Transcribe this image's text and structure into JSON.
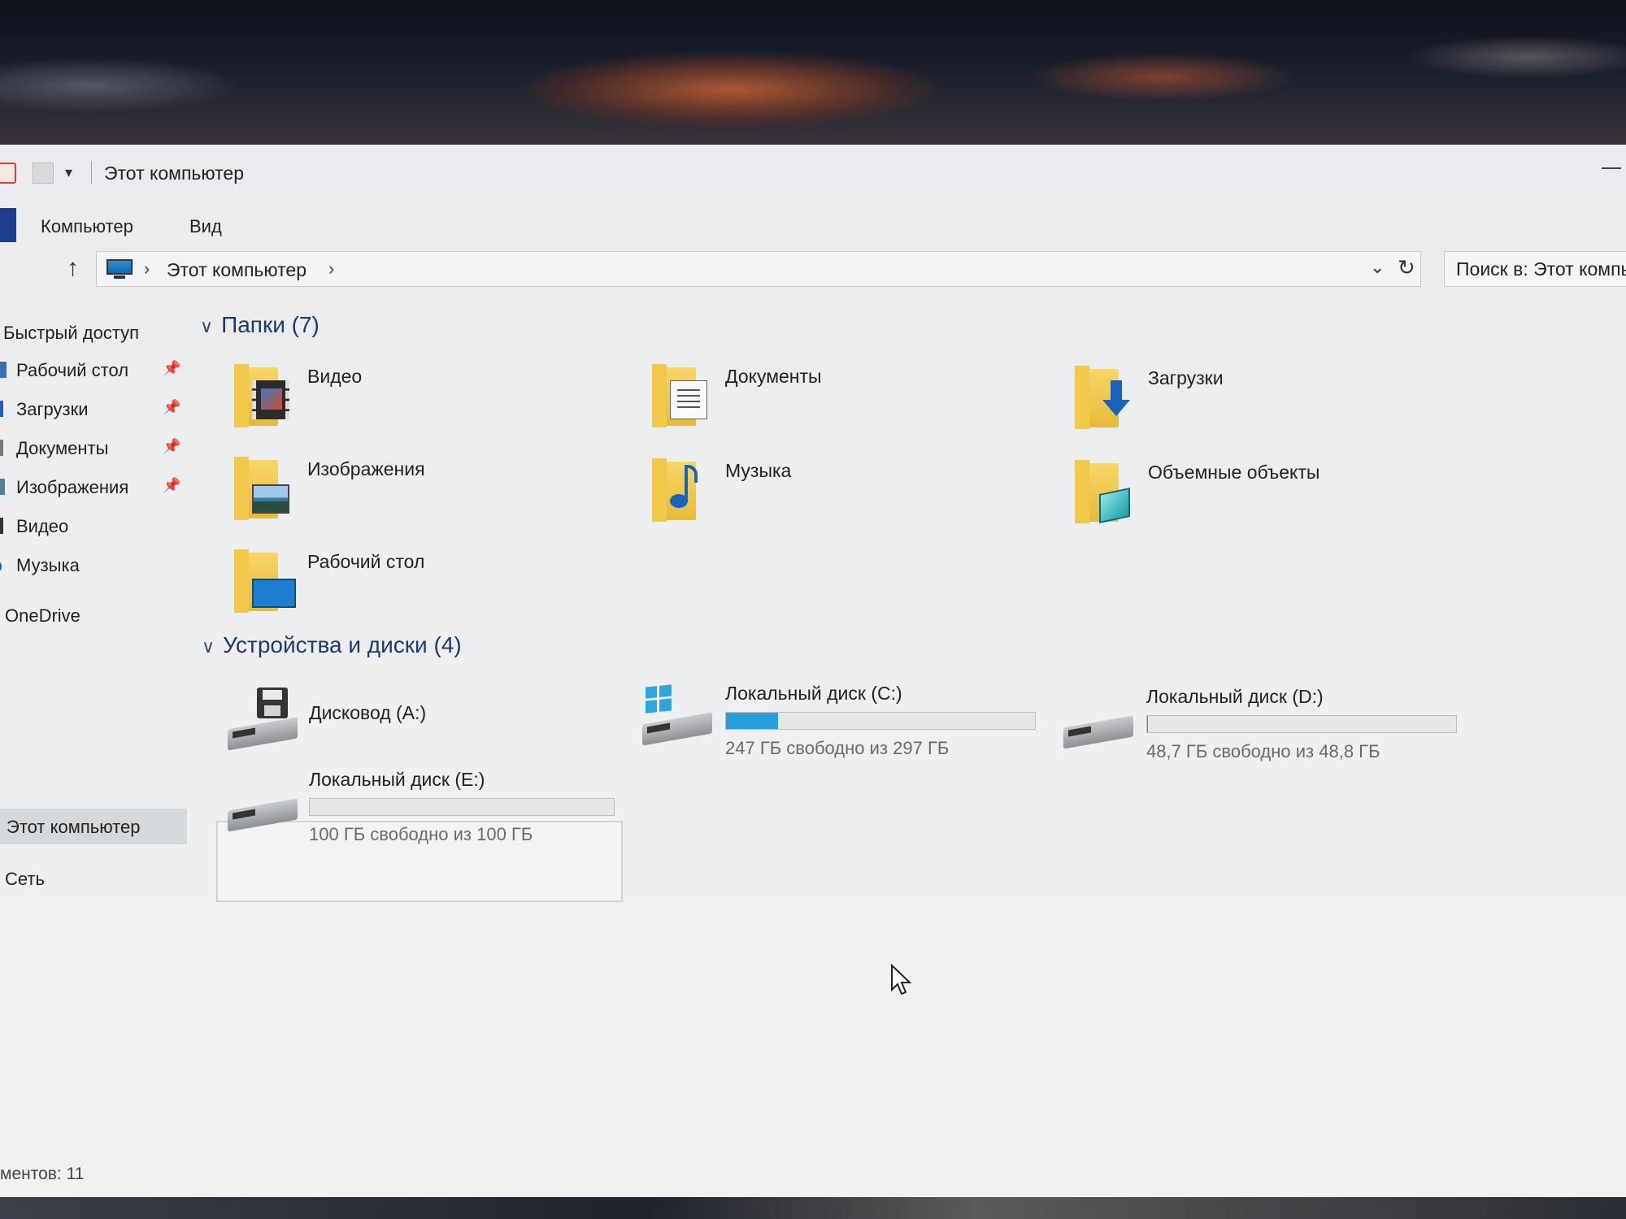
{
  "window": {
    "title": "Этот компьютер"
  },
  "ribbon": {
    "tabs": {
      "computer": "Компьютер",
      "view": "Вид"
    }
  },
  "address": {
    "crumb": "Этот компьютер",
    "search_placeholder": "Поиск в: Этот компьютер"
  },
  "sidebar": {
    "quick_access": "Быстрый доступ",
    "pinned": [
      {
        "label": "Рабочий стол"
      },
      {
        "label": "Загрузки"
      },
      {
        "label": "Документы"
      },
      {
        "label": "Изображения"
      }
    ],
    "items": [
      {
        "label": "Видео"
      },
      {
        "label": "Музыка"
      }
    ],
    "onedrive": "OneDrive",
    "this_pc": "Этот компьютер",
    "network": "Сеть"
  },
  "folders": {
    "header": "Папки (7)",
    "items": [
      {
        "label": "Видео",
        "icon": "video-folder-icon"
      },
      {
        "label": "Документы",
        "icon": "documents-folder-icon"
      },
      {
        "label": "Загрузки",
        "icon": "downloads-folder-icon"
      },
      {
        "label": "Изображения",
        "icon": "pictures-folder-icon"
      },
      {
        "label": "Музыка",
        "icon": "music-folder-icon"
      },
      {
        "label": "Объемные объекты",
        "icon": "3d-objects-folder-icon"
      },
      {
        "label": "Рабочий стол",
        "icon": "desktop-folder-icon"
      }
    ]
  },
  "devices": {
    "header": "Устройства и диски (4)",
    "items": [
      {
        "label": "Дисковод (A:)",
        "icon": "floppy-drive-icon"
      },
      {
        "label": "Локальный диск (C:)",
        "free_text": "247 ГБ свободно из 297 ГБ",
        "used_fraction": 0.168,
        "icon": "system-drive-icon"
      },
      {
        "label": "Локальный диск (D:)",
        "free_text": "48,7 ГБ свободно из 48,8 ГБ",
        "used_fraction": 0.002,
        "icon": "hard-drive-icon"
      },
      {
        "label": "Локальный диск (E:)",
        "free_text": "100 ГБ свободно из 100 ГБ",
        "used_fraction": 0.0,
        "icon": "hard-drive-icon"
      }
    ]
  },
  "status_bar": {
    "text": "ментов: 11"
  },
  "colors": {
    "progress_fill": "#26a0da",
    "selected_bg": "#d6d9dc",
    "header_text": "#1e3a6a"
  }
}
